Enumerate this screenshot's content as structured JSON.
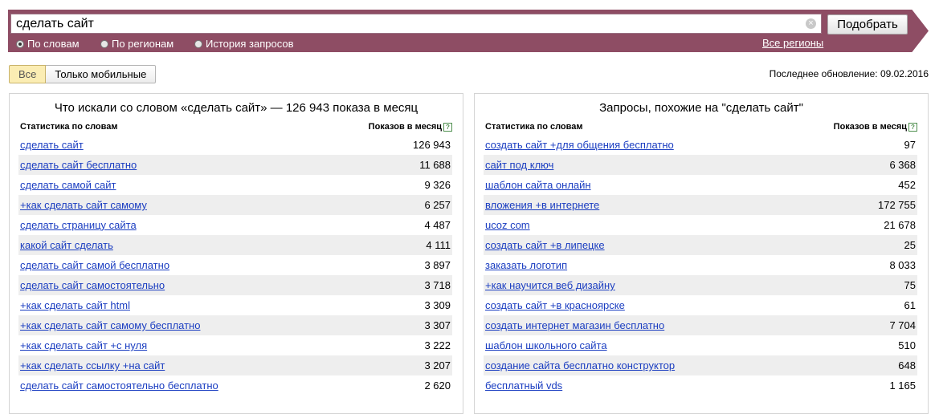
{
  "search": {
    "query": "сделать сайт",
    "button_label": "Подобрать"
  },
  "modes": [
    {
      "label": "По словам",
      "selected": true
    },
    {
      "label": "По регионам",
      "selected": false
    },
    {
      "label": "История запросов",
      "selected": false
    }
  ],
  "all_regions": "Все регионы",
  "tabs": {
    "all": "Все",
    "mobile": "Только мобильные"
  },
  "last_update": "Последнее обновление: 09.02.2016",
  "left_panel": {
    "title": "Что искали со словом «сделать сайт» — 126 943 показа в месяц",
    "col_words": "Статистика по словам",
    "col_shows": "Показов в месяц",
    "rows": [
      {
        "keyword": "сделать сайт",
        "count": "126 943"
      },
      {
        "keyword": "сделать сайт бесплатно",
        "count": "11 688"
      },
      {
        "keyword": "сделать самой сайт",
        "count": "9 326"
      },
      {
        "keyword": "+как сделать сайт самому",
        "count": "6 257"
      },
      {
        "keyword": "сделать страницу сайта",
        "count": "4 487"
      },
      {
        "keyword": "какой сайт сделать",
        "count": "4 111"
      },
      {
        "keyword": "сделать сайт самой бесплатно",
        "count": "3 897"
      },
      {
        "keyword": "сделать сайт самостоятельно",
        "count": "3 718"
      },
      {
        "keyword": "+как сделать сайт html",
        "count": "3 309"
      },
      {
        "keyword": "+как сделать сайт самому бесплатно",
        "count": "3 307"
      },
      {
        "keyword": "+как сделать сайт +с нуля",
        "count": "3 222"
      },
      {
        "keyword": "+как сделать ссылку +на сайт",
        "count": "3 207"
      },
      {
        "keyword": "сделать сайт самостоятельно бесплатно",
        "count": "2 620"
      }
    ]
  },
  "right_panel": {
    "title": "Запросы, похожие на \"сделать сайт\"",
    "col_words": "Статистика по словам",
    "col_shows": "Показов в месяц",
    "rows": [
      {
        "keyword": "создать сайт +для общения бесплатно",
        "count": "97"
      },
      {
        "keyword": "сайт под ключ",
        "count": "6 368"
      },
      {
        "keyword": "шаблон сайта онлайн",
        "count": "452"
      },
      {
        "keyword": "вложения +в интернете",
        "count": "172 755"
      },
      {
        "keyword": "ucoz com",
        "count": "21 678"
      },
      {
        "keyword": "создать сайт +в липецке",
        "count": "25"
      },
      {
        "keyword": "заказать логотип",
        "count": "8 033"
      },
      {
        "keyword": "+как научится веб дизайну",
        "count": "75"
      },
      {
        "keyword": "создать сайт +в красноярске",
        "count": "61"
      },
      {
        "keyword": "создать интернет магазин бесплатно",
        "count": "7 704"
      },
      {
        "keyword": "шаблон школьного сайта",
        "count": "510"
      },
      {
        "keyword": "создание сайта бесплатно конструктор",
        "count": "648"
      },
      {
        "keyword": "бесплатный vds",
        "count": "1 165"
      }
    ]
  }
}
